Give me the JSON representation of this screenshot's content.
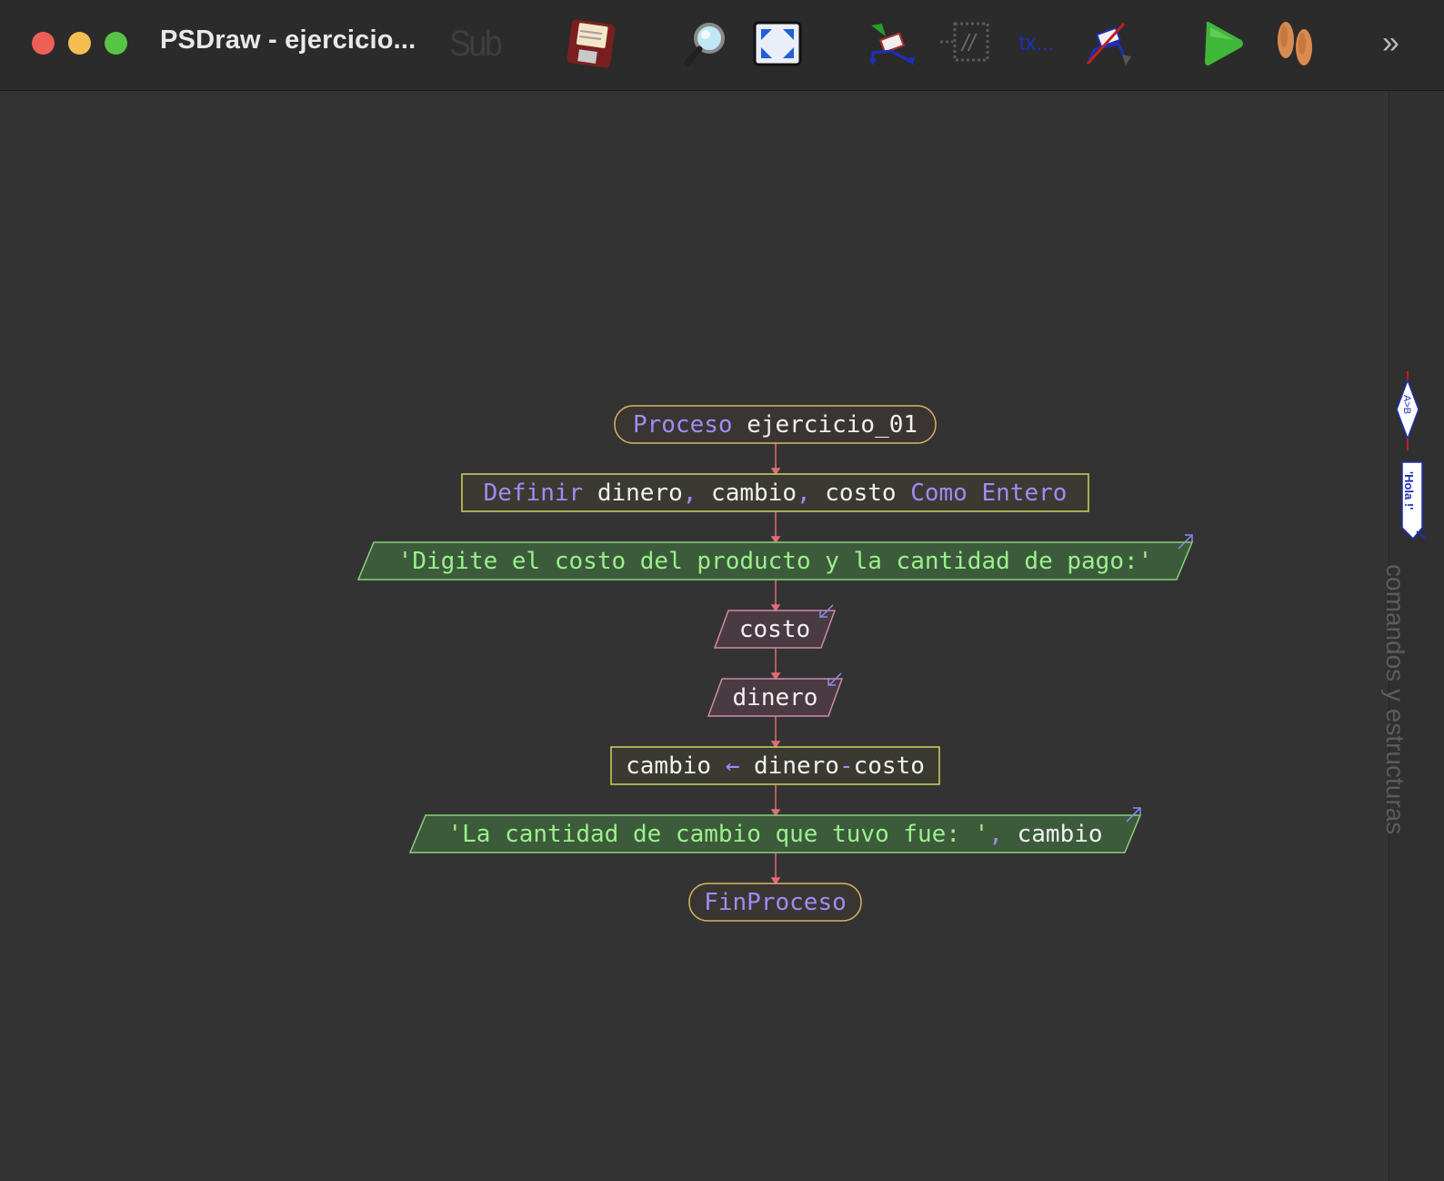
{
  "window": {
    "title": "PSDraw - ejercicio..."
  },
  "toolbar": {
    "sub_label": "Sub",
    "text_label": "tx...",
    "icons": [
      "save-icon",
      "zoom-icon",
      "fit-screen-icon",
      "move-icon",
      "comment-icon",
      "text-icon",
      "delete-icon",
      "run-icon",
      "step-icon",
      "more-icon"
    ],
    "more_glyph": "»"
  },
  "sidebar": {
    "label": "comandos y estructuras",
    "decision_tool_text": "A>B",
    "output_tool_text": "'Hola !'"
  },
  "flowchart": {
    "start": {
      "keyword": "Proceso",
      "name": "ejercicio_01"
    },
    "define": {
      "keyword": "Definir",
      "vars": [
        "dinero",
        "cambio",
        "costo"
      ],
      "sep": ",",
      "type_kw1": "Como",
      "type_kw2": "Entero"
    },
    "output1": {
      "text": "'Digite el costo del producto y la cantidad de pago:'"
    },
    "input1": {
      "var": "costo"
    },
    "input2": {
      "var": "dinero"
    },
    "assign": {
      "target": "cambio",
      "arrow": "←",
      "expr_left": "dinero",
      "op": "-",
      "expr_right": "costo"
    },
    "output2": {
      "text": "'La cantidad de cambio que tuvo fue: '",
      "sep": ",",
      "var": "cambio"
    },
    "end": {
      "keyword": "FinProceso"
    }
  },
  "colors": {
    "keyword": "#9f8cf5",
    "string": "#9bf08e",
    "connector": "#e06c75",
    "terminal_border": "#d7b65c",
    "define_border": "#d2d15d",
    "output_fill": "#3c5b3a",
    "output_border": "#8ad07a",
    "input_fill": "#4a3b42",
    "input_border": "#d08aa8"
  }
}
